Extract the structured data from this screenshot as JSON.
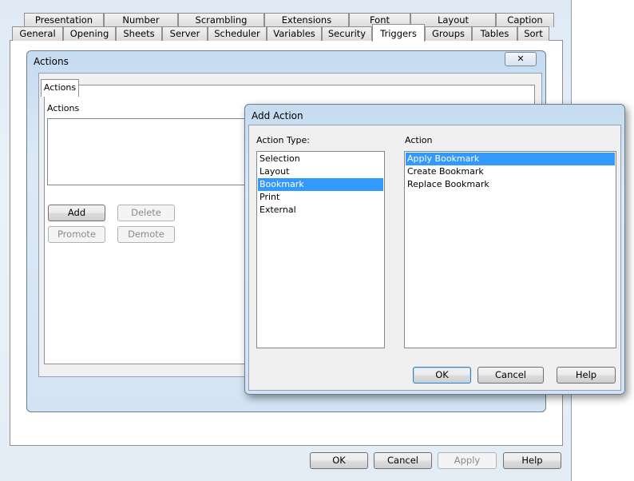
{
  "properties_window": {
    "tabs_row1": [
      "Presentation",
      "Number",
      "Scrambling",
      "Extensions",
      "Font",
      "Layout",
      "Caption"
    ],
    "tabs_row2": [
      "General",
      "Opening",
      "Sheets",
      "Server",
      "Scheduler",
      "Variables",
      "Security",
      "Triggers",
      "Groups",
      "Tables",
      "Sort"
    ],
    "selected_tab": "Triggers",
    "buttons": {
      "ok": "OK",
      "cancel": "Cancel",
      "apply": "Apply",
      "help": "Help"
    }
  },
  "actions_dialog": {
    "title": "Actions",
    "close": "✕",
    "tab": "Actions",
    "list_label": "Actions",
    "buttons": {
      "add": "Add",
      "delete": "Delete",
      "promote": "Promote",
      "demote": "Demote"
    }
  },
  "add_action_dialog": {
    "title": "Add Action",
    "action_type_label": "Action Type:",
    "action_types": [
      "Selection",
      "Layout",
      "Bookmark",
      "Print",
      "External"
    ],
    "selected_action_type": "Bookmark",
    "action_label": "Action",
    "actions": [
      "Apply Bookmark",
      "Create Bookmark",
      "Replace Bookmark"
    ],
    "selected_action": "Apply Bookmark",
    "buttons": {
      "ok": "OK",
      "cancel": "Cancel",
      "help": "Help"
    }
  },
  "colors": {
    "selection": "#3399ff",
    "title_bar": "#c5dbf0"
  }
}
